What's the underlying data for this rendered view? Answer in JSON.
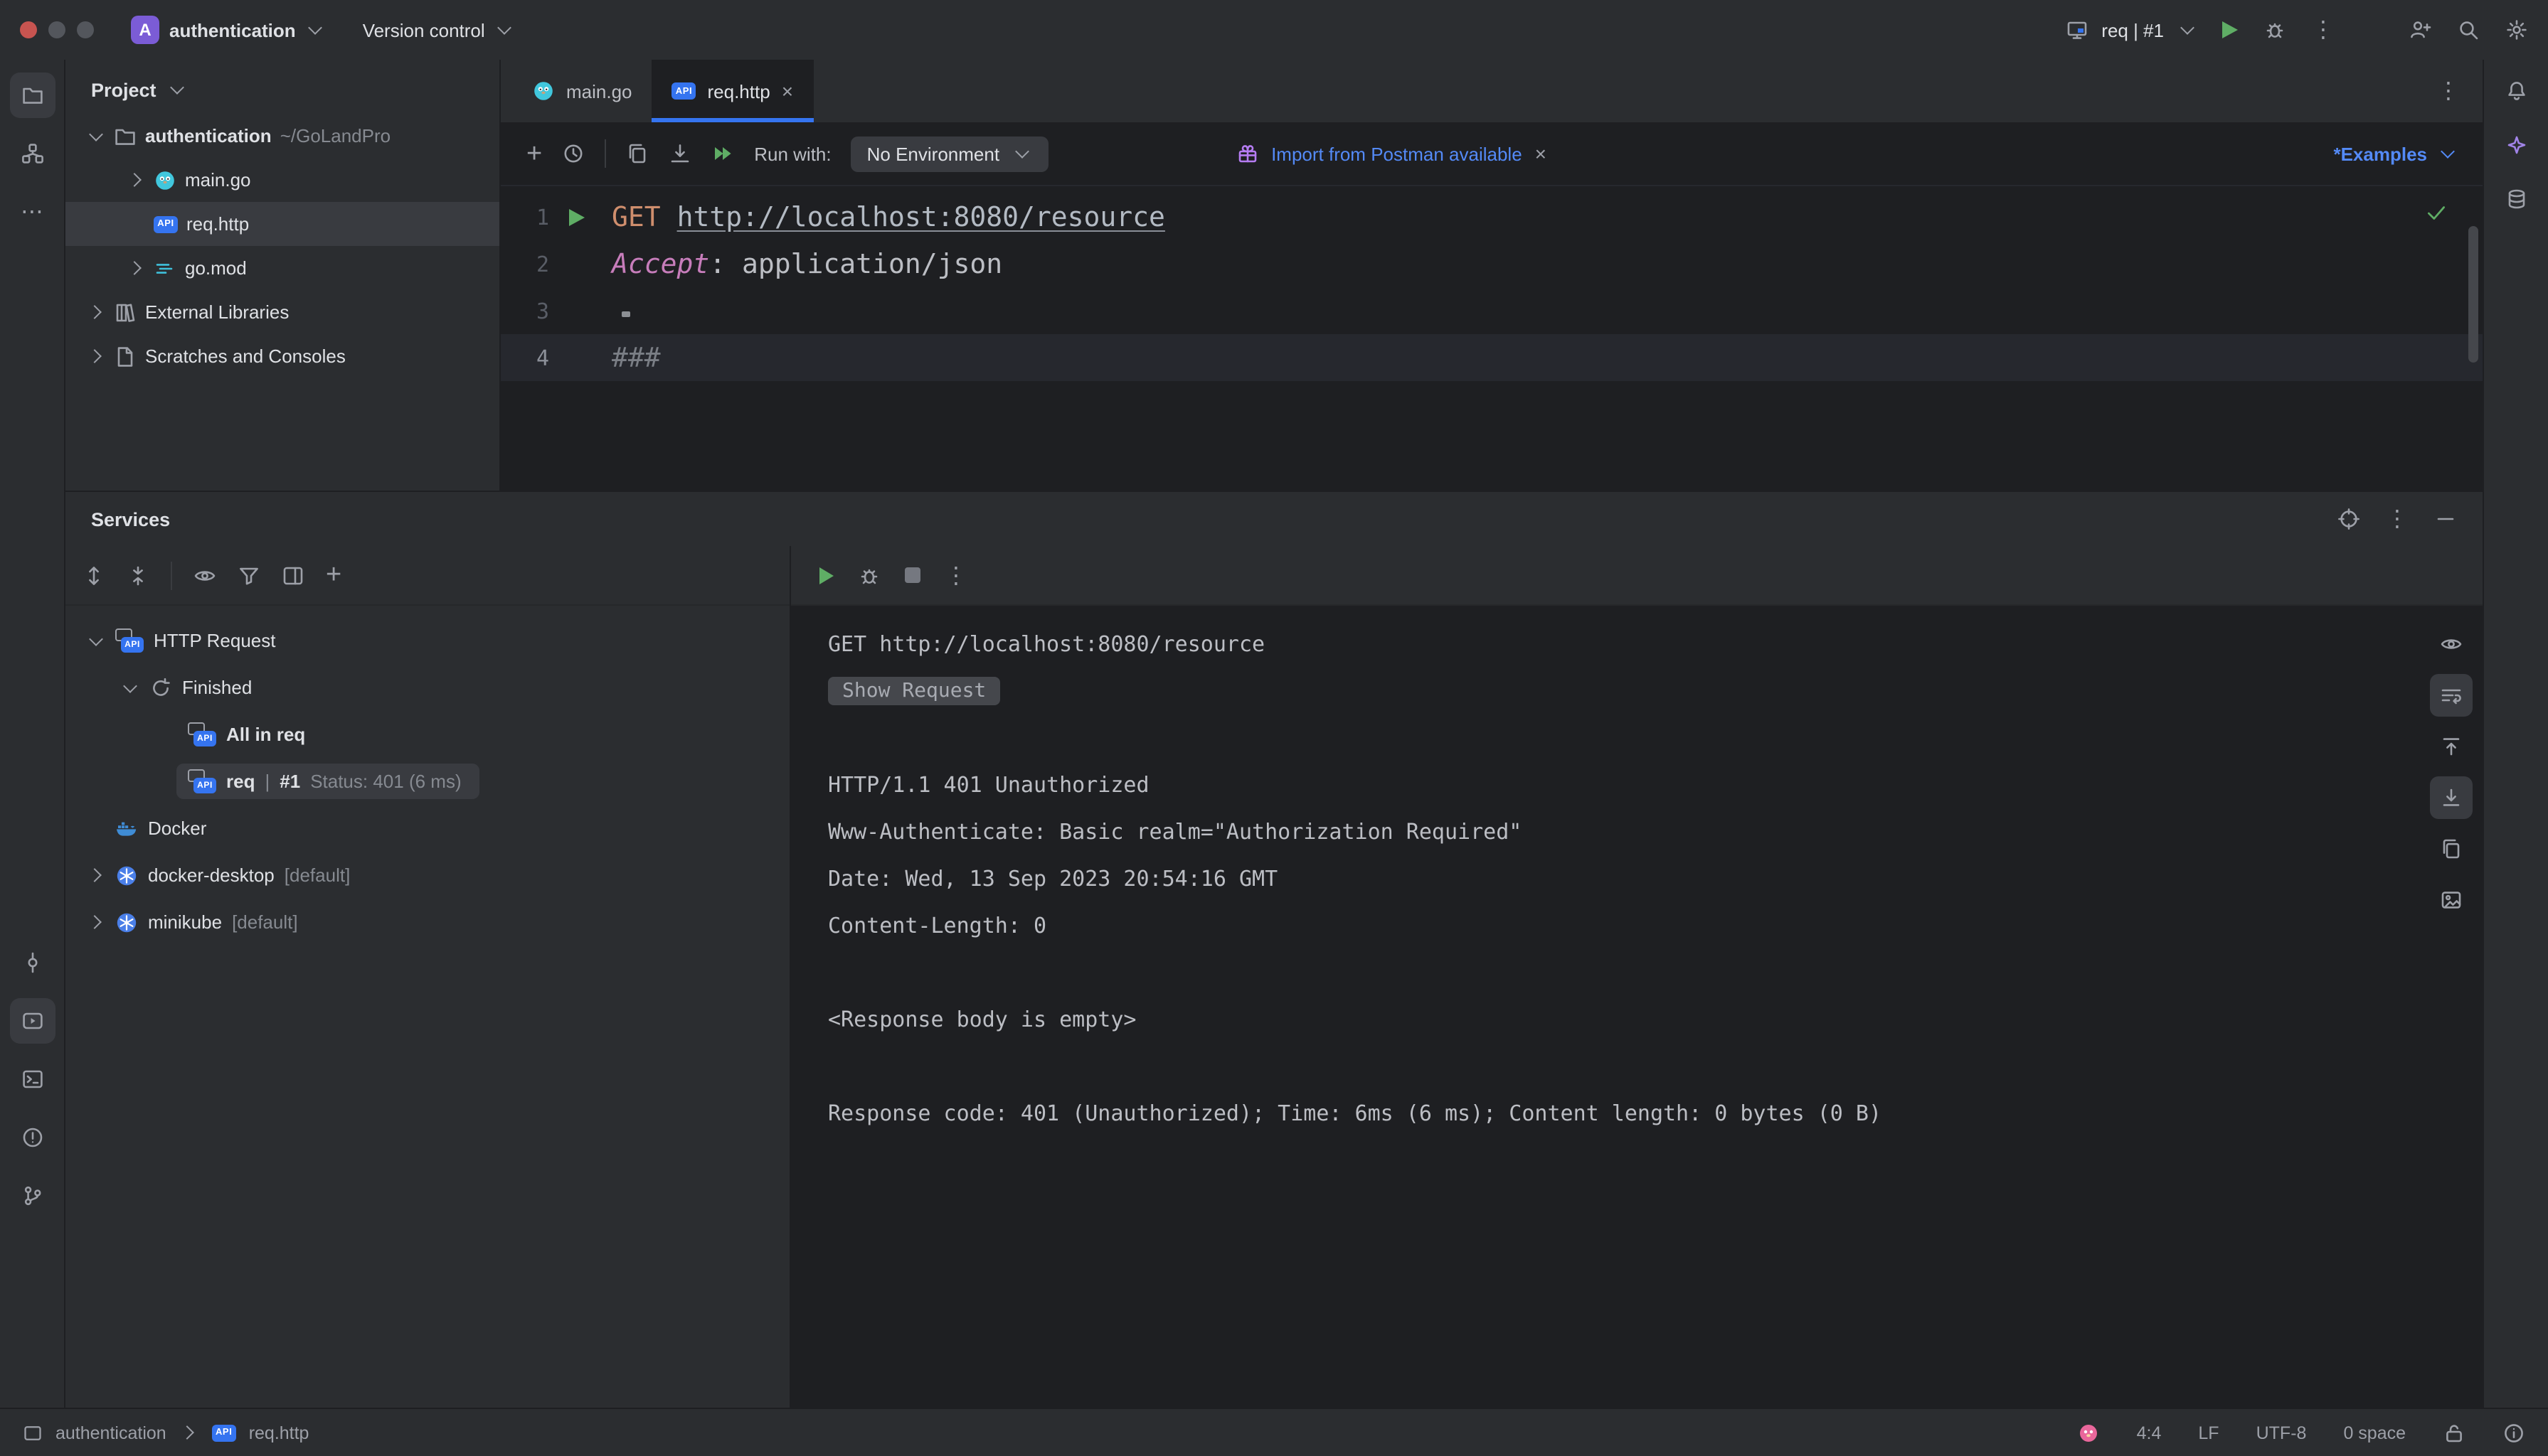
{
  "colors": {
    "accent_blue": "#3574f0",
    "link_blue": "#548af7",
    "run_green": "#5fad65",
    "selection_gray": "#393b40",
    "editor_bg": "#1e1f22",
    "panel_bg": "#2b2d30",
    "method_orange": "#cf8e6d",
    "header_purple": "#c77dbb"
  },
  "icons": {
    "api_label": "API"
  },
  "titlebar": {
    "project": "authentication",
    "project_initial": "A",
    "vcs": "Version control",
    "run_config": "req | #1"
  },
  "project_panel": {
    "header": "Project",
    "root": "authentication",
    "root_path": "~/GoLandPro",
    "main_go": "main.go",
    "req_http": "req.http",
    "go_mod": "go.mod",
    "external_libraries": "External Libraries",
    "scratches": "Scratches and Consoles"
  },
  "tabs": {
    "main_go": "main.go",
    "req_http": "req.http",
    "close": "×"
  },
  "editor_toolbar": {
    "run_with": "Run with:",
    "environment": "No Environment",
    "banner": "Import from Postman available",
    "banner_close": "×",
    "examples": "*Examples"
  },
  "editor": {
    "line_numbers": [
      "1",
      "2",
      "3",
      "4"
    ],
    "method": "GET",
    "url": "http://localhost:8080/resource",
    "header_name": "Accept",
    "header_value": ": application/json",
    "separator": "###"
  },
  "services": {
    "title": "Services",
    "tree": {
      "http_request": "HTTP Request",
      "finished": "Finished",
      "all_in_req": "All in req",
      "req": "req",
      "divider": "|",
      "req_id": "#1",
      "req_status": "Status: 401 (6 ms)",
      "docker": "Docker",
      "docker_desktop": "docker-desktop",
      "minikube": "minikube",
      "default_suffix": "[default]"
    },
    "console": {
      "request": "GET http://localhost:8080/resource",
      "show_request": "Show Request",
      "status": "HTTP/1.1 401 Unauthorized",
      "www_authenticate": "Www-Authenticate: Basic realm=\"Authorization Required\"",
      "date": "Date: Wed, 13 Sep 2023 20:54:16 GMT",
      "content_length": "Content-Length: 0",
      "empty_body": "<Response body is empty>",
      "summary": "Response code: 401 (Unauthorized); Time: 6ms (6 ms); Content length: 0 bytes (0 B)"
    }
  },
  "statusbar": {
    "project": "authentication",
    "file": "req.http",
    "caret": "4:4",
    "line_ending": "LF",
    "encoding": "UTF-8",
    "indent": "0 space"
  }
}
